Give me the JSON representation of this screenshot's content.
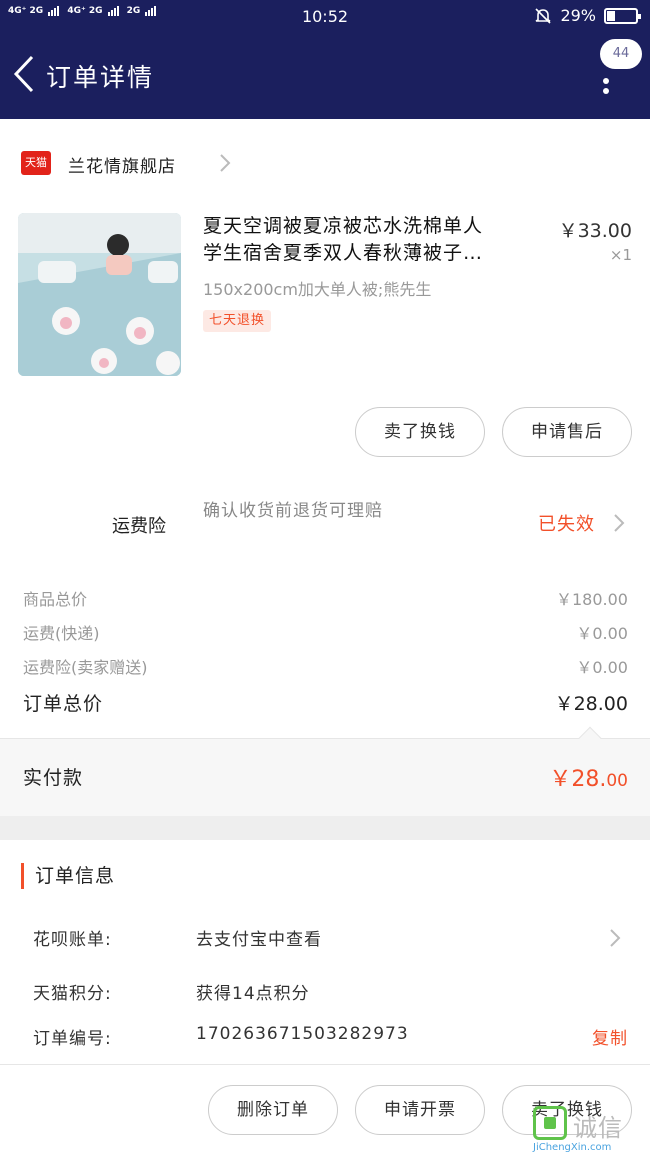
{
  "status_bar": {
    "network": [
      "4G⁺ 2G",
      "4G⁺ 2G",
      "2G"
    ],
    "time": "10:52",
    "battery": "29%"
  },
  "nav": {
    "back_icon": "chevron-left-icon",
    "title": "订单详情",
    "badge": "44",
    "more_icon": "more-vertical-icon"
  },
  "shop": {
    "badge": "天猫",
    "name": "兰花情旗舰店"
  },
  "product": {
    "title_line1": "夏天空调被夏凉被芯水洗棉单人",
    "title_line2": "学生宿舍夏季双人春秋薄被子…",
    "sku": "150x200cm加大单人被;熊先生",
    "tag": "七天退换",
    "price": "￥33.00",
    "qty": "×1"
  },
  "product_actions": {
    "sell_label": "卖了换钱",
    "after_sale_label": "申请售后"
  },
  "insurance": {
    "label": "运费险",
    "desc": "确认收货前退货可理赔",
    "status": "已失效"
  },
  "costs": {
    "goods_label": "商品总价",
    "goods_value": "￥180.00",
    "shipping_label": "运费(快递)",
    "shipping_value": "￥0.00",
    "ins_label": "运费险(卖家赠送)",
    "ins_value": "￥0.00",
    "total_label": "订单总价",
    "total_value": "￥28.00"
  },
  "paid": {
    "label": "实付款",
    "main": "￥28.",
    "cents": "00"
  },
  "order_info": {
    "title": "订单信息",
    "huabei_label": "花呗账单:",
    "huabei_value": "去支付宝中查看",
    "points_label": "天猫积分:",
    "points_value": "获得14点积分",
    "order_no_label": "订单编号:",
    "order_no_value": "170263671503282973",
    "copy_label": "复制"
  },
  "bottom_actions": {
    "delete_label": "删除订单",
    "invoice_label": "申请开票",
    "sell_label": "卖了换钱"
  },
  "watermark": {
    "cn": "诚信",
    "url": "JiChengXin.com"
  },
  "colors": {
    "nav_bg": "#1b1f5e",
    "accent": "#f2502a",
    "tmall_red": "#e2231a"
  }
}
